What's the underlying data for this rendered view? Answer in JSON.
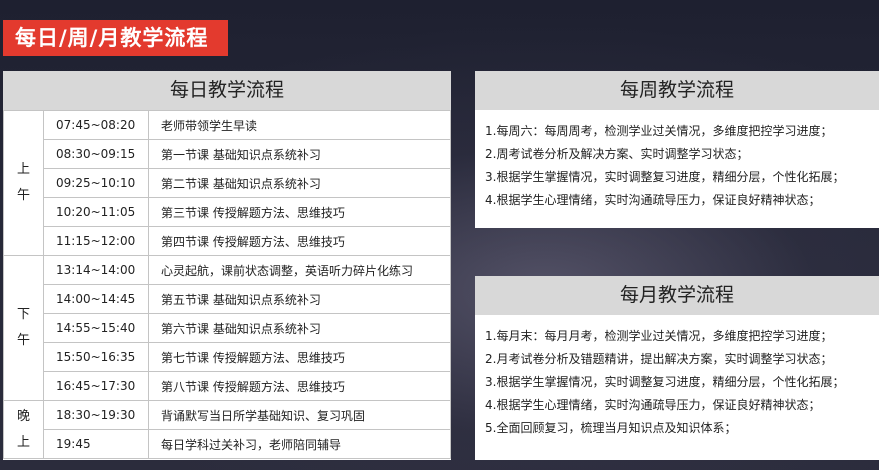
{
  "banner": "每日/周/月教学流程",
  "daily": {
    "title": "每日教学流程",
    "groups": [
      {
        "label": [
          "上",
          "午"
        ],
        "rows": [
          {
            "time": "07:45~08:20",
            "activity": "老师带领学生早读"
          },
          {
            "time": "08:30~09:15",
            "activity": "第一节课 基础知识点系统补习"
          },
          {
            "time": "09:25~10:10",
            "activity": "第二节课 基础知识点系统补习"
          },
          {
            "time": "10:20~11:05",
            "activity": "第三节课 传授解题方法、思维技巧"
          },
          {
            "time": "11:15~12:00",
            "activity": "第四节课 传授解题方法、思维技巧"
          }
        ]
      },
      {
        "label": [
          "下",
          "午"
        ],
        "rows": [
          {
            "time": "13:14~14:00",
            "activity": "心灵起航，课前状态调整，英语听力碎片化练习"
          },
          {
            "time": "14:00~14:45",
            "activity": "第五节课 基础知识点系统补习"
          },
          {
            "time": "14:55~15:40",
            "activity": "第六节课 基础知识点系统补习"
          },
          {
            "time": "15:50~16:35",
            "activity": "第七节课 传授解题方法、思维技巧"
          },
          {
            "time": "16:45~17:30",
            "activity": "第八节课 传授解题方法、思维技巧"
          }
        ]
      },
      {
        "label": [
          "晚",
          "上"
        ],
        "rows": [
          {
            "time": "18:30~19:30",
            "activity": "背诵默写当日所学基础知识、复习巩固"
          },
          {
            "time": "19:45",
            "activity": "每日学科过关补习，老师陪同辅导"
          }
        ]
      }
    ]
  },
  "weekly": {
    "title": "每周教学流程",
    "items": [
      "1.每周六：每周周考，检测学业过关情况，多维度把控学习进度；",
      "2.周考试卷分析及解决方案、实时调整学习状态；",
      "3.根据学生掌握情况，实时调整复习进度，精细分层，个性化拓展；",
      "4.根据学生心理情绪，实时沟通疏导压力，保证良好精神状态；"
    ]
  },
  "monthly": {
    "title": "每月教学流程",
    "items": [
      "1.每月末：每月月考，检测学业过关情况，多维度把控学习进度；",
      "2.月考试卷分析及错题精讲，提出解决方案，实时调整学习状态；",
      "3.根据学生掌握情况，实时调整复习进度，精细分层，个性化拓展；",
      "4.根据学生心理情绪，实时沟通疏导压力，保证良好精神状态；",
      "5.全面回顾复习，梳理当月知识点及知识体系；"
    ]
  }
}
